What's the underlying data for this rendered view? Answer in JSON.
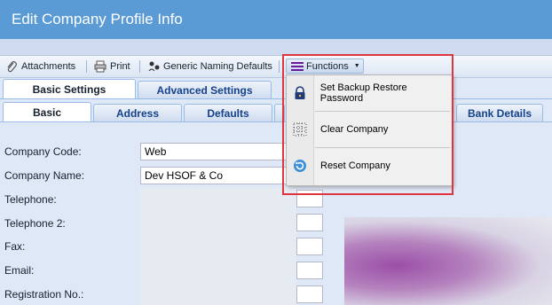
{
  "window": {
    "title": "Edit Company Profile Info"
  },
  "toolbar": {
    "attachments_label": "Attachments",
    "print_label": "Print",
    "generic_naming_label": "Generic Naming Defaults",
    "functions_label": "Functions"
  },
  "functions_menu": {
    "items": [
      {
        "label": "Set Backup Restore Password",
        "icon": "lock-icon"
      },
      {
        "label": "Clear Company",
        "icon": "grid-icon"
      },
      {
        "label": "Reset Company",
        "icon": "refresh-icon"
      }
    ]
  },
  "tabs_primary": [
    {
      "label": "Basic Settings",
      "active": true
    },
    {
      "label": "Advanced Settings",
      "active": false
    }
  ],
  "tabs_secondary": [
    {
      "label": "Basic",
      "active": true
    },
    {
      "label": "Address",
      "active": false
    },
    {
      "label": "Defaults",
      "active": false
    },
    {
      "label": "Bank Details",
      "active": false
    }
  ],
  "form": {
    "company_code_label": "Company Code:",
    "company_code_value": "Web",
    "company_name_label": "Company Name:",
    "company_name_value": "Dev HSOF & Co",
    "telephone_label": "Telephone:",
    "telephone2_label": "Telephone 2:",
    "fax_label": "Fax:",
    "email_label": "Email:",
    "registration_label": "Registration No.:"
  },
  "colors": {
    "title_bar": "#5b9bd5",
    "highlight_border": "#e0343f",
    "functions_icon": "#6a1b9a"
  }
}
